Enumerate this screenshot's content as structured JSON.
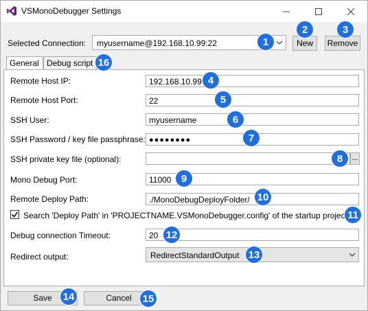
{
  "window": {
    "title": "VSMonoDebugger Settings"
  },
  "connection": {
    "label": "Selected Connection:",
    "value": "myusername@192.168.10.99:22",
    "new_label": "New",
    "remove_label": "Remove"
  },
  "tabs": [
    {
      "label": "General",
      "active": true
    },
    {
      "label": "Debug script",
      "active": false
    }
  ],
  "fields": {
    "remote_host_ip": {
      "label": "Remote Host IP:",
      "value": "192.168.10.99"
    },
    "remote_host_port": {
      "label": "Remote Host Port:",
      "value": "22"
    },
    "ssh_user": {
      "label": "SSH User:",
      "value": "myusername"
    },
    "ssh_password": {
      "label": "SSH Password / key file passphrase:",
      "value": "●●●●●●●●"
    },
    "ssh_private_key": {
      "label": "SSH private key file (optional):",
      "value": "",
      "browse_label": "..."
    },
    "mono_debug_port": {
      "label": "Mono Debug Port:",
      "value": "11000"
    },
    "remote_deploy_path": {
      "label": "Remote Deploy Path:",
      "value": "./MonoDebugDeployFolder/"
    },
    "search_deploy_path": {
      "label": "Search 'Deploy Path' in 'PROJECTNAME.VSMonoDebugger.config' of the startup project.",
      "checked": true
    },
    "debug_timeout": {
      "label": "Debug connection Timeout:",
      "value": "20"
    },
    "redirect_output": {
      "label": "Redirect output:",
      "value": "RedirectStandardOutput"
    }
  },
  "footer": {
    "save_label": "Save",
    "cancel_label": "Cancel"
  },
  "badges": [
    "1",
    "2",
    "3",
    "4",
    "5",
    "6",
    "7",
    "8",
    "9",
    "10",
    "11",
    "12",
    "13",
    "14",
    "15",
    "16"
  ],
  "colors": {
    "badge": "#1f6fe0",
    "window_bg": "#f0f0f0",
    "logo": "#68217a"
  },
  "icons": {
    "logo": "visual-studio-logo",
    "minimize": "minimize-icon",
    "maximize": "maximize-icon",
    "close": "close-icon",
    "dropdown": "chevron-down-icon",
    "checkbox": "check-icon"
  }
}
